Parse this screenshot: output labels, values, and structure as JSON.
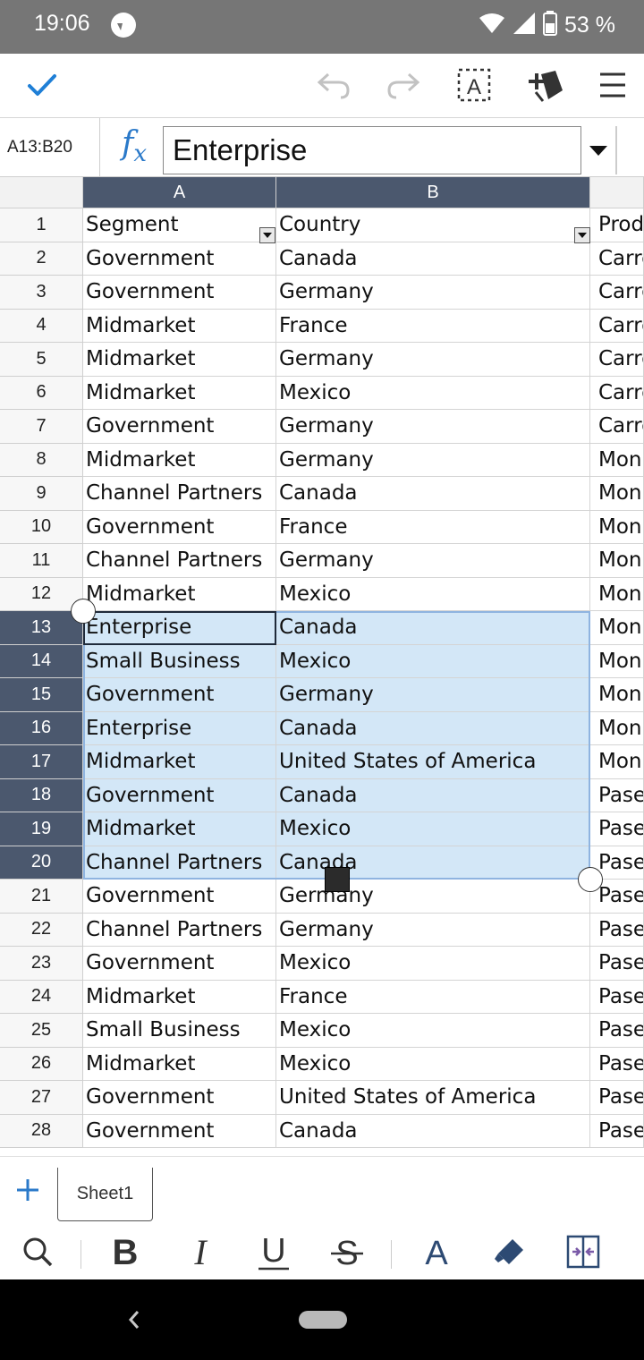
{
  "status_bar": {
    "time": "19:06",
    "battery": "53 %"
  },
  "toolbar": {
    "confirm": "check-icon",
    "undo": "undo-icon",
    "redo": "redo-icon",
    "text_select": "text-select-icon",
    "insert": "insert-icon",
    "menu": "menu-icon"
  },
  "formula_bar": {
    "cell_ref": "A13:B20",
    "value": "Enterprise"
  },
  "columns": [
    "A",
    "B"
  ],
  "rows": [
    {
      "n": "1",
      "a": "Segment",
      "b": "Country",
      "c": "Prod"
    },
    {
      "n": "2",
      "a": "Government",
      "b": "Canada",
      "c": "Carre"
    },
    {
      "n": "3",
      "a": "Government",
      "b": "Germany",
      "c": "Carre"
    },
    {
      "n": "4",
      "a": "Midmarket",
      "b": "France",
      "c": "Carre"
    },
    {
      "n": "5",
      "a": "Midmarket",
      "b": "Germany",
      "c": "Carre"
    },
    {
      "n": "6",
      "a": "Midmarket",
      "b": "Mexico",
      "c": "Carre"
    },
    {
      "n": "7",
      "a": "Government",
      "b": "Germany",
      "c": "Carre"
    },
    {
      "n": "8",
      "a": "Midmarket",
      "b": "Germany",
      "c": "Mon"
    },
    {
      "n": "9",
      "a": "Channel Partners",
      "b": "Canada",
      "c": "Mon"
    },
    {
      "n": "10",
      "a": "Government",
      "b": "France",
      "c": "Mon"
    },
    {
      "n": "11",
      "a": "Channel Partners",
      "b": "Germany",
      "c": "Mon"
    },
    {
      "n": "12",
      "a": "Midmarket",
      "b": "Mexico",
      "c": "Mon"
    },
    {
      "n": "13",
      "a": "Enterprise",
      "b": "Canada",
      "c": "Mon"
    },
    {
      "n": "14",
      "a": "Small Business",
      "b": "Mexico",
      "c": "Mon"
    },
    {
      "n": "15",
      "a": "Government",
      "b": "Germany",
      "c": "Mon"
    },
    {
      "n": "16",
      "a": "Enterprise",
      "b": "Canada",
      "c": "Mon"
    },
    {
      "n": "17",
      "a": "Midmarket",
      "b": "United States of America",
      "c": "Mon"
    },
    {
      "n": "18",
      "a": "Government",
      "b": "Canada",
      "c": "Pase"
    },
    {
      "n": "19",
      "a": "Midmarket",
      "b": "Mexico",
      "c": "Pase"
    },
    {
      "n": "20",
      "a": "Channel Partners",
      "b": "Canada",
      "c": "Pase"
    },
    {
      "n": "21",
      "a": "Government",
      "b": "Germany",
      "c": "Pase"
    },
    {
      "n": "22",
      "a": "Channel Partners",
      "b": "Germany",
      "c": "Pase"
    },
    {
      "n": "23",
      "a": "Government",
      "b": "Mexico",
      "c": "Pase"
    },
    {
      "n": "24",
      "a": "Midmarket",
      "b": "France",
      "c": "Pase"
    },
    {
      "n": "25",
      "a": "Small Business",
      "b": "Mexico",
      "c": "Pase"
    },
    {
      "n": "26",
      "a": "Midmarket",
      "b": "Mexico",
      "c": "Pase"
    },
    {
      "n": "27",
      "a": "Government",
      "b": "United States of America",
      "c": "Pase"
    },
    {
      "n": "28",
      "a": "Government",
      "b": "Canada",
      "c": "Pase"
    }
  ],
  "selection": {
    "first_row": 13,
    "last_row": 20
  },
  "sheets": [
    {
      "label": "Sheet1"
    }
  ],
  "format_bar": [
    "search-icon",
    "bold-icon",
    "italic-icon",
    "underline-icon",
    "strikethrough-icon",
    "font-color-icon",
    "fill-color-icon",
    "merge-cells-icon"
  ],
  "colors": {
    "header_selected": "#4b586e",
    "selection_fill": "#d3e7f7",
    "accent": "#2a79c9"
  }
}
